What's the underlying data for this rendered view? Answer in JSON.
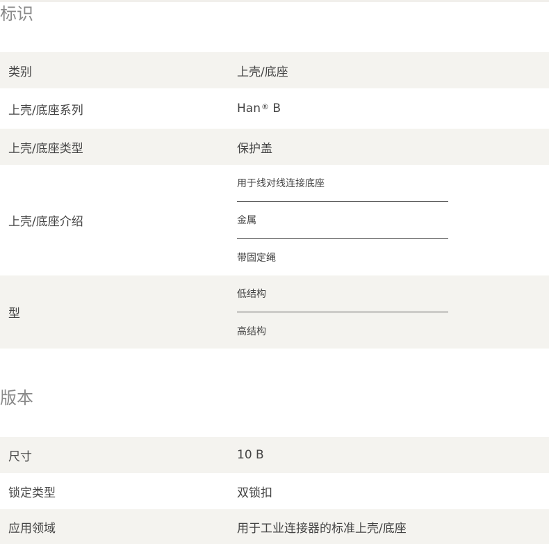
{
  "identification": {
    "title": "标识",
    "rows": [
      {
        "label": "类别",
        "value": "上壳/底座"
      },
      {
        "label": "上壳/底座系列",
        "value": "Han",
        "value_sup": "®",
        "value_suffix": " B"
      },
      {
        "label": "上壳/底座类型",
        "value": "保护盖"
      },
      {
        "label": "上壳/底座介绍",
        "items": [
          "用于线对线连接底座",
          "金属",
          "带固定绳"
        ]
      },
      {
        "label": "型",
        "items": [
          "低结构",
          "高结构"
        ]
      }
    ]
  },
  "version": {
    "title": "版本",
    "rows": [
      {
        "label": "尺寸",
        "value": "10 B"
      },
      {
        "label": "锁定类型",
        "value": "双锁扣"
      },
      {
        "label": "应用领域",
        "value": "用于工业连接器的标准上壳/底座"
      }
    ]
  }
}
